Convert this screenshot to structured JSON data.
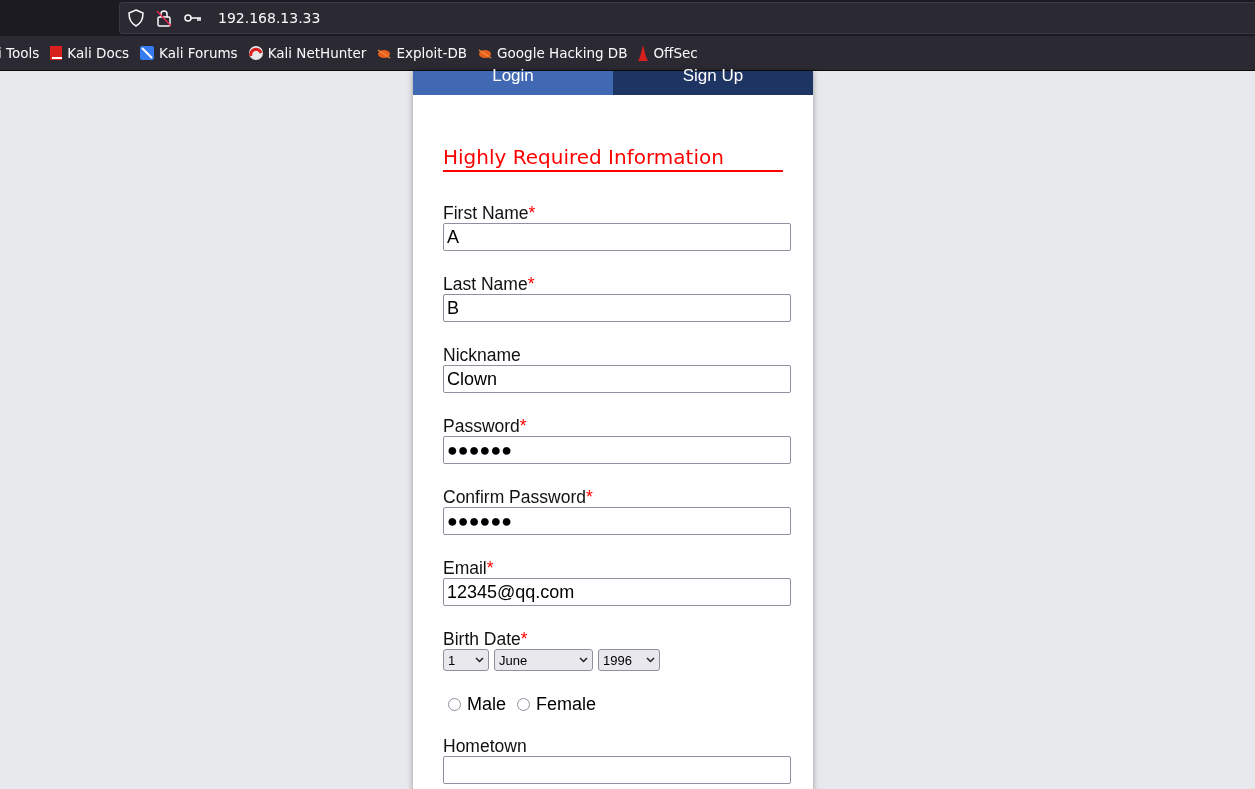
{
  "browser": {
    "url": "192.168.13.33",
    "bookmarks": [
      {
        "label": "i Tools",
        "kind": "none"
      },
      {
        "label": "Kali Docs",
        "kind": "docs"
      },
      {
        "label": "Kali Forums",
        "kind": "forums"
      },
      {
        "label": "Kali NetHunter",
        "kind": "nethunter"
      },
      {
        "label": "Exploit-DB",
        "kind": "bug"
      },
      {
        "label": "Google Hacking DB",
        "kind": "bug"
      },
      {
        "label": "OffSec",
        "kind": "offsec"
      }
    ]
  },
  "tabs": [
    {
      "label": "Login",
      "selected": true
    },
    {
      "label": "Sign Up",
      "selected": false
    }
  ],
  "form": {
    "heading": "Highly Required Information",
    "fields": [
      {
        "kind": "text",
        "label": "First Name",
        "required_mark": "*",
        "value": "A"
      },
      {
        "kind": "text",
        "label": "Last Name",
        "required_mark": "*",
        "value": "B"
      },
      {
        "kind": "text",
        "label": "Nickname",
        "value": "Clown"
      },
      {
        "kind": "text",
        "label": "Password",
        "required_mark": "*",
        "value": "●●●●●●"
      },
      {
        "kind": "text",
        "label": "Confirm Password",
        "required_mark": "*",
        "value": "●●●●●●"
      },
      {
        "kind": "text",
        "label": "Email",
        "required_mark": "*",
        "value": "12345@qq.com"
      },
      {
        "kind": "date",
        "label": "Birth Date",
        "required_mark": "*",
        "day": "1",
        "month": "June",
        "year": "1996"
      },
      {
        "kind": "radio",
        "options": [
          {
            "label": "Male",
            "selected": false
          },
          {
            "label": "Female",
            "selected": false
          }
        ]
      },
      {
        "kind": "text",
        "label": "Hometown"
      }
    ]
  }
}
